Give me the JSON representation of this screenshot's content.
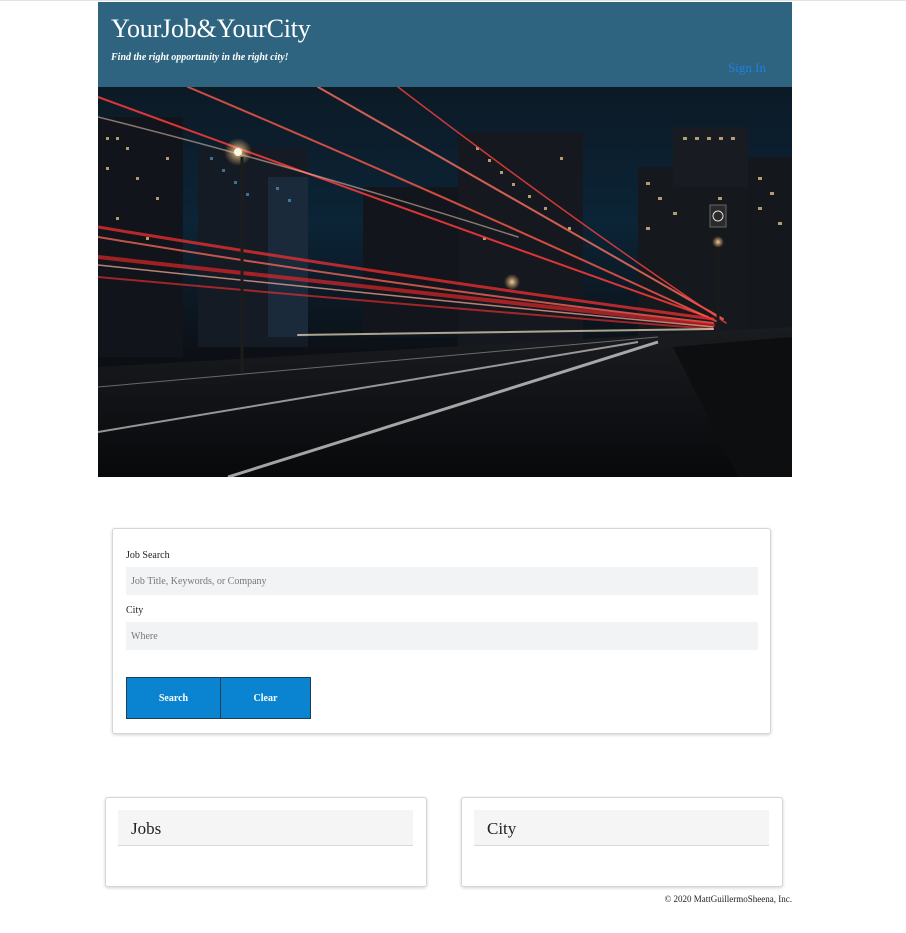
{
  "header": {
    "title": "YourJob&YourCity",
    "tagline": "Find the right opportunity in the right city!",
    "sign_in_label": "Sign In"
  },
  "hero": {
    "image_description": "hero-photo"
  },
  "search": {
    "job_label": "Job Search",
    "job_placeholder": "Job Title, Keywords, or Company",
    "city_label": "City",
    "city_placeholder": "Where",
    "search_button": "Search",
    "clear_button": "Clear"
  },
  "panels": {
    "jobs_title": "Jobs",
    "city_title": "City"
  },
  "footer": {
    "copyright": "© 2020 MattGuillermoSheena, Inc."
  },
  "colors": {
    "header_bg": "#2e6480",
    "button_bg": "#0a84d0",
    "link": "#1f7fe6"
  }
}
